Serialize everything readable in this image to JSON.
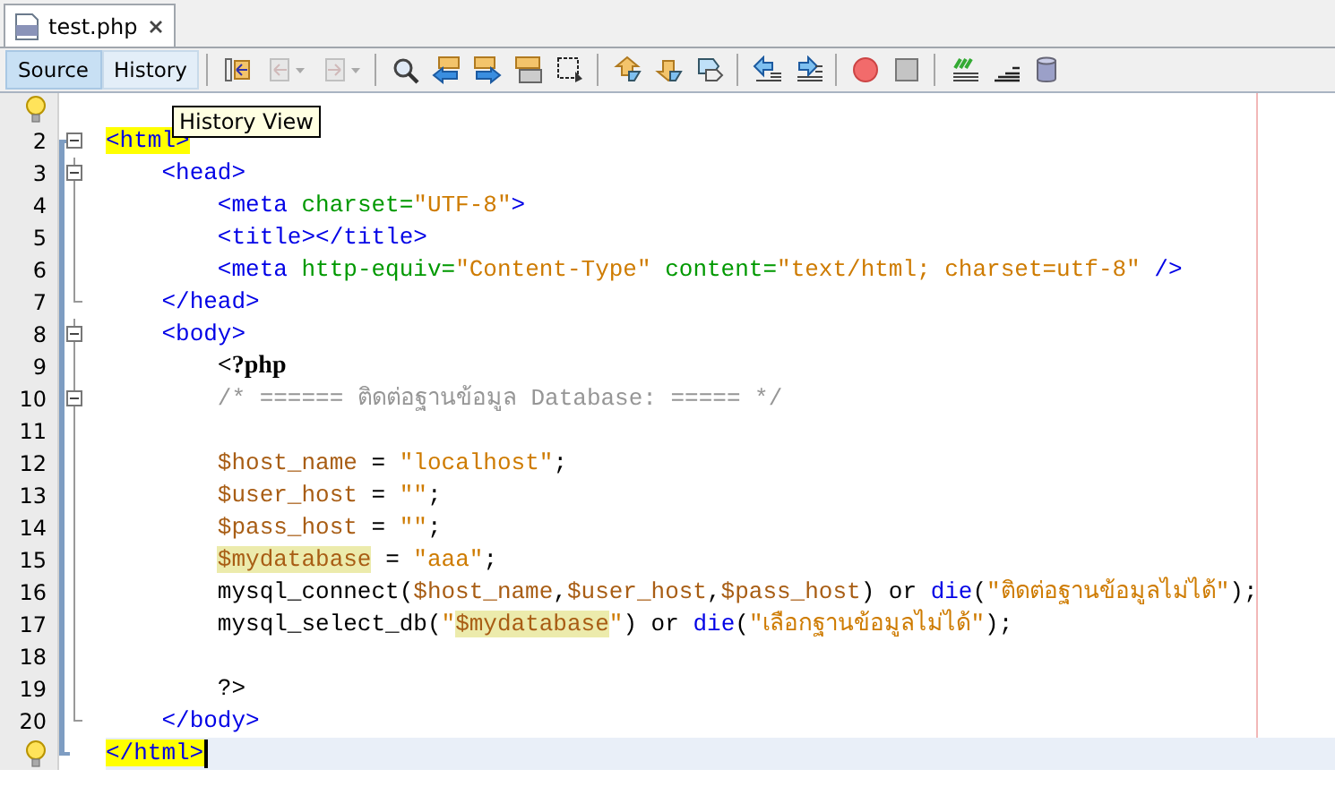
{
  "file_tab": {
    "title": "test.php",
    "selected": true
  },
  "view_tabs": [
    {
      "label": "Source",
      "selected": true
    },
    {
      "label": "History",
      "selected": false
    }
  ],
  "toolbar": [
    {
      "kind": "last-edit",
      "disabled": false
    },
    {
      "kind": "back",
      "disabled": true
    },
    {
      "kind": "forward",
      "disabled": true
    },
    {
      "kind": "separator"
    },
    {
      "kind": "find",
      "disabled": false
    },
    {
      "kind": "find-previous",
      "disabled": false
    },
    {
      "kind": "find-next",
      "disabled": false
    },
    {
      "kind": "highlight",
      "disabled": false
    },
    {
      "kind": "rect-select",
      "disabled": false
    },
    {
      "kind": "separator"
    },
    {
      "kind": "bookmark-previous",
      "disabled": false
    },
    {
      "kind": "bookmark-next",
      "disabled": false
    },
    {
      "kind": "bookmark-toggle",
      "disabled": false
    },
    {
      "kind": "separator"
    },
    {
      "kind": "shift-left",
      "disabled": false
    },
    {
      "kind": "shift-right",
      "disabled": false
    },
    {
      "kind": "separator"
    },
    {
      "kind": "record",
      "disabled": false
    },
    {
      "kind": "stop",
      "disabled": false
    },
    {
      "kind": "separator"
    },
    {
      "kind": "comment",
      "disabled": false
    },
    {
      "kind": "uncomment",
      "disabled": false
    },
    {
      "kind": "database",
      "disabled": false
    }
  ],
  "tooltip": "History View",
  "editor": {
    "lines": [
      {
        "hint": true,
        "kind": "plain",
        "current": false
      },
      {
        "number": "2",
        "hint": false,
        "kind": "fold-start",
        "current": false,
        "tokens": [
          {
            "kind": "tag-matched",
            "t": "<html>"
          }
        ]
      },
      {
        "number": "3",
        "hint": false,
        "kind": "fold-start",
        "current": false,
        "tokens": [
          {
            "kind": "tag",
            "t": "    <head>"
          }
        ]
      },
      {
        "number": "4",
        "hint": false,
        "kind": "plain",
        "current": false,
        "tokens": [
          {
            "kind": "tag",
            "t": "        <meta "
          },
          {
            "kind": "attr",
            "t": "charset="
          },
          {
            "kind": "str",
            "t": "\"UTF-8\""
          },
          {
            "kind": "tag",
            "t": ">"
          }
        ]
      },
      {
        "number": "5",
        "hint": false,
        "kind": "plain",
        "current": false,
        "tokens": [
          {
            "kind": "tag",
            "t": "        <title></title>"
          }
        ]
      },
      {
        "number": "6",
        "hint": false,
        "kind": "plain",
        "current": false,
        "tokens": [
          {
            "kind": "tag",
            "t": "        <meta "
          },
          {
            "kind": "attr",
            "t": "http-equiv="
          },
          {
            "kind": "str",
            "t": "\"Content-Type\" "
          },
          {
            "kind": "attr",
            "t": "content="
          },
          {
            "kind": "str",
            "t": "\"text/html; charset=utf-8\" "
          },
          {
            "kind": "tag",
            "t": "/>"
          }
        ]
      },
      {
        "number": "7",
        "hint": false,
        "kind": "fold-end",
        "current": false,
        "tokens": [
          {
            "kind": "tag",
            "t": "    </head>"
          }
        ]
      },
      {
        "number": "8",
        "hint": false,
        "kind": "fold-start",
        "current": false,
        "tokens": [
          {
            "kind": "tag",
            "t": "    <body>"
          }
        ]
      },
      {
        "number": "9",
        "hint": false,
        "kind": "plain",
        "current": false,
        "tokens": [
          {
            "kind": "php",
            "t": "        <?php"
          }
        ]
      },
      {
        "number": "10",
        "hint": false,
        "kind": "fold-single",
        "current": false,
        "tokens": [
          {
            "kind": "comment",
            "t": "        /* ====== ติดต่อฐานข้อมูล Database: ===== */"
          }
        ]
      },
      {
        "number": "11",
        "hint": false,
        "kind": "plain",
        "current": false
      },
      {
        "number": "12",
        "hint": false,
        "kind": "plain",
        "current": false,
        "tokens": [
          {
            "kind": "var",
            "t": "        $host_name"
          },
          {
            "kind": "plain",
            "t": " = "
          },
          {
            "kind": "str",
            "t": "\"localhost\""
          },
          {
            "kind": "plain",
            "t": ";"
          }
        ]
      },
      {
        "number": "13",
        "hint": false,
        "kind": "plain",
        "current": false,
        "tokens": [
          {
            "kind": "var",
            "t": "        $user_host"
          },
          {
            "kind": "plain",
            "t": " = "
          },
          {
            "kind": "str",
            "t": "\"\""
          },
          {
            "kind": "plain",
            "t": ";"
          }
        ]
      },
      {
        "number": "14",
        "hint": false,
        "kind": "plain",
        "current": false,
        "tokens": [
          {
            "kind": "var",
            "t": "        $pass_host"
          },
          {
            "kind": "plain",
            "t": " = "
          },
          {
            "kind": "str",
            "t": "\"\""
          },
          {
            "kind": "plain",
            "t": ";"
          }
        ]
      },
      {
        "number": "15",
        "hint": false,
        "kind": "plain",
        "current": false,
        "tokens": [
          {
            "kind": "var-occurrence",
            "t": "        $mydatabase"
          },
          {
            "kind": "plain",
            "t": " = "
          },
          {
            "kind": "str",
            "t": "\"aaa\""
          },
          {
            "kind": "plain",
            "t": ";"
          }
        ]
      },
      {
        "number": "16",
        "hint": false,
        "kind": "plain",
        "current": false,
        "tokens": [
          {
            "kind": "plain",
            "t": "        mysql_connect("
          },
          {
            "kind": "var",
            "t": "$host_name"
          },
          {
            "kind": "plain",
            "t": ","
          },
          {
            "kind": "var",
            "t": "$user_host"
          },
          {
            "kind": "plain",
            "t": ","
          },
          {
            "kind": "var",
            "t": "$pass_host"
          },
          {
            "kind": "plain",
            "t": ") or "
          },
          {
            "kind": "fn",
            "t": "die"
          },
          {
            "kind": "plain",
            "t": "("
          },
          {
            "kind": "str",
            "t": "\"ติดต่อฐานข้อมูลไม่ได้\""
          },
          {
            "kind": "plain",
            "t": ");"
          }
        ]
      },
      {
        "number": "17",
        "hint": false,
        "kind": "plain",
        "current": false,
        "tokens": [
          {
            "kind": "plain",
            "t": "        mysql_select_db("
          },
          {
            "kind": "str",
            "t": "\""
          },
          {
            "kind": "var-occurrence",
            "t": "$mydatabase"
          },
          {
            "kind": "str",
            "t": "\""
          },
          {
            "kind": "plain",
            "t": ") or "
          },
          {
            "kind": "fn",
            "t": "die"
          },
          {
            "kind": "plain",
            "t": "("
          },
          {
            "kind": "str",
            "t": "\"เลือกฐานข้อมูลไม่ได้\""
          },
          {
            "kind": "plain",
            "t": ");"
          }
        ]
      },
      {
        "number": "18",
        "hint": false,
        "kind": "plain",
        "current": false
      },
      {
        "number": "19",
        "hint": false,
        "kind": "plain",
        "current": false,
        "tokens": [
          {
            "kind": "plain",
            "t": "        ?>"
          }
        ]
      },
      {
        "number": "20",
        "hint": false,
        "kind": "fold-end",
        "current": false,
        "tokens": [
          {
            "kind": "tag",
            "t": "    </body>"
          }
        ]
      },
      {
        "hint": true,
        "kind": "fold-end",
        "current": true,
        "tokens": [
          {
            "kind": "tag-matched",
            "t": "</html>"
          }
        ]
      }
    ]
  }
}
